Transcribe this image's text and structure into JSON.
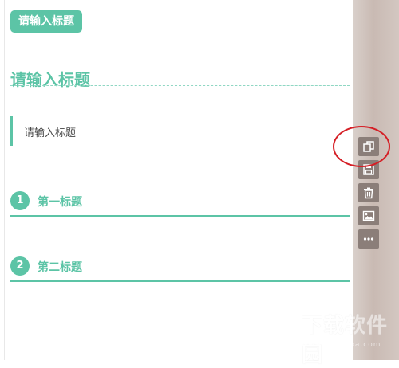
{
  "pill_title": "请输入标题",
  "section_title": "请输入标题",
  "quote_text": "请输入标题",
  "numbered_headings": [
    {
      "number": "1",
      "label": "第一标题"
    },
    {
      "number": "2",
      "label": "第二标题"
    }
  ],
  "toolbar": [
    {
      "icon": "copy-icon"
    },
    {
      "icon": "save-icon"
    },
    {
      "icon": "trash-icon"
    },
    {
      "icon": "image-icon"
    },
    {
      "icon": "more-icon"
    }
  ],
  "watermark": {
    "text": "下载软件园",
    "url": "www.xiazaiba.com"
  },
  "colors": {
    "accent": "#5cc4a6",
    "toolbar_button": "#8b7e79",
    "highlight_ring": "#d51f26"
  }
}
